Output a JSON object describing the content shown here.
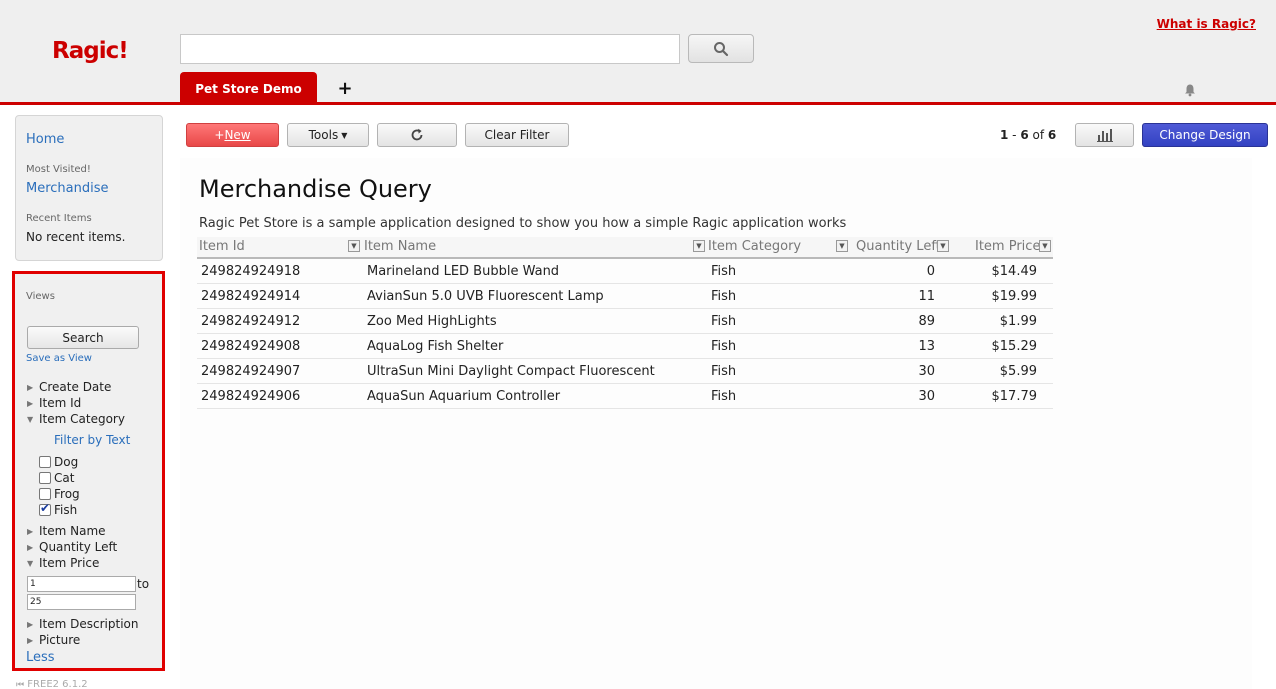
{
  "header": {
    "logo": "Ragic!",
    "search_placeholder": "",
    "what_is_link": "What is Ragic?",
    "active_tab": "Pet Store Demo",
    "add_tab": "+"
  },
  "sidebar": {
    "home": "Home",
    "most_visited_label": "Most Visited!",
    "most_visited_item": "Merchandise",
    "recent_label": "Recent Items",
    "recent_empty": "No recent items.",
    "views_label": "Views",
    "search_button": "Search",
    "save_as_view": "Save as View",
    "fields": {
      "create_date": "Create Date",
      "item_id": "Item Id",
      "item_category": "Item Category",
      "filter_by_text": "Filter by Text",
      "item_name": "Item Name",
      "quantity_left": "Quantity Left",
      "item_price": "Item Price",
      "item_description": "Item Description",
      "picture": "Picture"
    },
    "category_options": [
      {
        "label": "Dog",
        "checked": false
      },
      {
        "label": "Cat",
        "checked": false
      },
      {
        "label": "Frog",
        "checked": false
      },
      {
        "label": "Fish",
        "checked": true
      }
    ],
    "price_from": "1",
    "price_to": "25",
    "range_to_label": "to",
    "less": "Less",
    "version": "FREE2 6.1.2"
  },
  "toolbar": {
    "new_prefix": "+",
    "new_label": "New",
    "tools_label": "Tools",
    "clear_filter": "Clear Filter",
    "pager_start": "1",
    "pager_end": "6",
    "pager_total": "6",
    "pager_sep": " - ",
    "pager_of": " of ",
    "change_design": "Change Design"
  },
  "main": {
    "title": "Merchandise Query",
    "description": "Ragic Pet Store is a sample application designed to show you how a simple Ragic application works",
    "columns": [
      "Item Id",
      "Item Name",
      "Item Category",
      "Quantity Left",
      "Item Price"
    ],
    "rows": [
      {
        "id": "249824924918",
        "name": "Marineland LED Bubble Wand",
        "category": "Fish",
        "qty": "0",
        "price": "$14.49"
      },
      {
        "id": "249824924914",
        "name": "AvianSun 5.0 UVB Fluorescent Lamp",
        "category": "Fish",
        "qty": "11",
        "price": "$19.99"
      },
      {
        "id": "249824924912",
        "name": "Zoo Med HighLights",
        "category": "Fish",
        "qty": "89",
        "price": "$1.99"
      },
      {
        "id": "249824924908",
        "name": "AquaLog Fish Shelter",
        "category": "Fish",
        "qty": "13",
        "price": "$15.29"
      },
      {
        "id": "249824924907",
        "name": "UltraSun Mini Daylight Compact Fluorescent",
        "category": "Fish",
        "qty": "30",
        "price": "$5.99"
      },
      {
        "id": "249824924906",
        "name": "AquaSun Aquarium Controller",
        "category": "Fish",
        "qty": "30",
        "price": "$17.79"
      }
    ]
  },
  "colors": {
    "brand_red": "#cc0000",
    "link_blue": "#2a6ebb",
    "design_button": "#3342c2"
  }
}
